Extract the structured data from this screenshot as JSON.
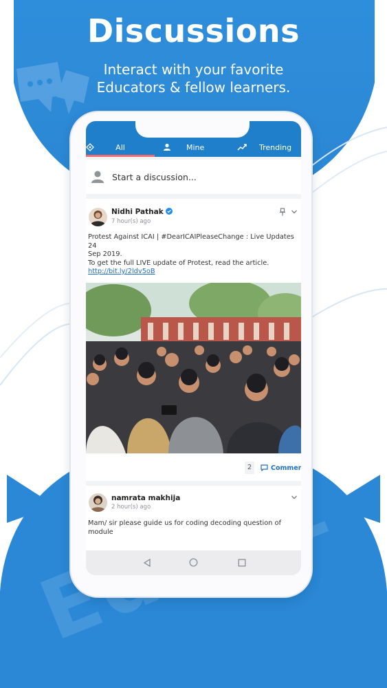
{
  "header": {
    "title": "Discussions",
    "subtitle_line1": "Interact with your favorite",
    "subtitle_line2": "Educators & fellow learners."
  },
  "brand_watermark": "Edu91",
  "colors": {
    "primary": "#1f7fcb",
    "background_blue": "#2a8ad8",
    "tab_indicator": "#f46b6b",
    "link": "#1f6fbd",
    "verified": "#1f8ef1"
  },
  "tabs": [
    {
      "label": "All",
      "icon": "discussion-icon",
      "active": true
    },
    {
      "label": "Mine",
      "icon": "person-icon",
      "active": false
    },
    {
      "label": "Trending",
      "icon": "trending-icon",
      "active": false
    }
  ],
  "composer": {
    "placeholder": "Start a discussion..."
  },
  "posts": [
    {
      "author": "Nidhi Pathak",
      "verified": true,
      "time": "7 hour(s) ago",
      "text_line1": "Protest Against ICAI | #DearICAIPleaseChange : Live Updates 24",
      "text_line2": "Sep 2019.",
      "text_line3": "To get the full LIVE update of Protest, read the article.",
      "link": "http://bit.ly/2ldv5oB",
      "comment_count": "2",
      "comment_label": "Comment"
    },
    {
      "author": "namrata makhija",
      "verified": false,
      "time": "2 hour(s) ago",
      "text_line1": "Mam/ sir please guide us for coding decoding question of module"
    }
  ],
  "system_nav": [
    "back-icon",
    "home-icon",
    "recents-icon"
  ]
}
